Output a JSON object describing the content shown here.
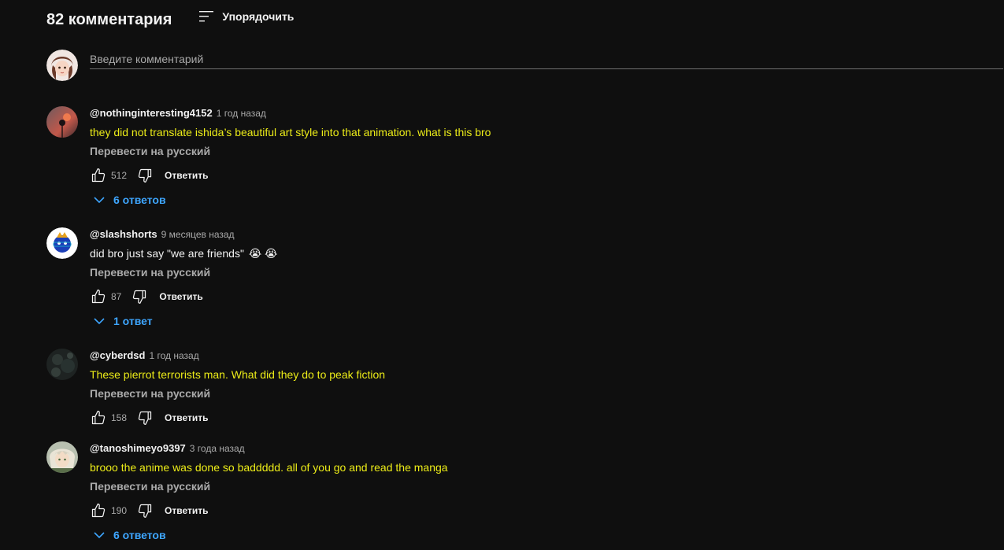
{
  "header": {
    "count_label": "82 комментария",
    "sort_label": "Упорядочить"
  },
  "composer": {
    "placeholder": "Введите комментарий"
  },
  "comments": [
    {
      "author": "@nothinginteresting4152",
      "time": "1 год назад",
      "text": "they did not translate ishida’s beautiful art style into that animation. what is this bro",
      "translate": "Перевести на русский",
      "likes": "512",
      "reply": "Ответить",
      "replies": "6 ответов"
    },
    {
      "author": "@slashshorts",
      "time": "9 месяцев назад",
      "text": "did bro just say \"we are friends\"",
      "emoji": "😭 😭",
      "translate": "Перевести на русский",
      "likes": "87",
      "reply": "Ответить",
      "replies": "1 ответ"
    },
    {
      "author": "@cyberdsd",
      "time": "1 год назад",
      "text": "These pierrot terrorists man. What did they do to peak fiction",
      "translate": "Перевести на русский",
      "likes": "158",
      "reply": "Ответить"
    },
    {
      "author": "@tanoshimeyo9397",
      "time": "3 года назад",
      "text": "brooo the anime was done so baddddd. all of you go and read the manga",
      "translate": "Перевести на русский",
      "likes": "190",
      "reply": "Ответить",
      "replies": "6 ответов"
    }
  ],
  "colors": {
    "background": "#0f0f0f",
    "highlight_text": "#ecec18",
    "link_blue": "#3ea6ff",
    "secondary_text": "#aaaaaa"
  }
}
